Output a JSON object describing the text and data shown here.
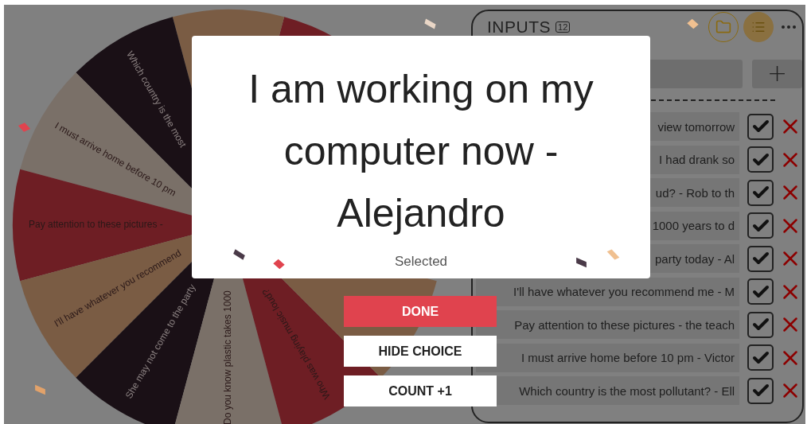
{
  "wheel": {
    "segments": [
      {
        "color": "#6e1e24"
      },
      {
        "color": "#7a5c44"
      },
      {
        "label": "Which country is the most",
        "color": "#1a1016"
      },
      {
        "label": "I must arrive home before 10 pm",
        "color": "#7a7068"
      },
      {
        "label": "Pay attention to these pictures -",
        "color": "#6e1e24"
      },
      {
        "label": "I'll have whatever you recommend",
        "color": "#7a5c44"
      },
      {
        "label": "She may not come to the party",
        "color": "#1a1016"
      },
      {
        "label": "Do you know plastic takes 1000",
        "color": "#7a7068"
      },
      {
        "label": "Who was playing music loud?",
        "color": "#6e1e24"
      },
      {
        "color": "#7a5c44"
      }
    ]
  },
  "panel": {
    "title": "INPUTS",
    "count": "12",
    "add_label": "+",
    "rows": [
      {
        "text": "view tomorrow",
        "checked": true
      },
      {
        "text": "I had drank so",
        "checked": true
      },
      {
        "text": "ud? - Rob to th",
        "checked": true
      },
      {
        "text": "1000 years to d",
        "checked": true
      },
      {
        "text": "party today - Al",
        "checked": true
      },
      {
        "text": "I'll have whatever you recommend me - M",
        "checked": true
      },
      {
        "text": "Pay attention to these pictures - the teach",
        "checked": true
      },
      {
        "text": "I must arrive home before 10 pm - Victor",
        "checked": true
      },
      {
        "text": "Which country is the most pollutant? - Ell",
        "checked": true
      }
    ]
  },
  "modal": {
    "title": "I am working on my computer now - Alejandro",
    "subtitle": "Selected",
    "buttons": [
      {
        "label": "DONE",
        "kind": "primary"
      },
      {
        "label": "HIDE CHOICE",
        "kind": "secondary"
      },
      {
        "label": "COUNT +1",
        "kind": "secondary"
      }
    ]
  }
}
